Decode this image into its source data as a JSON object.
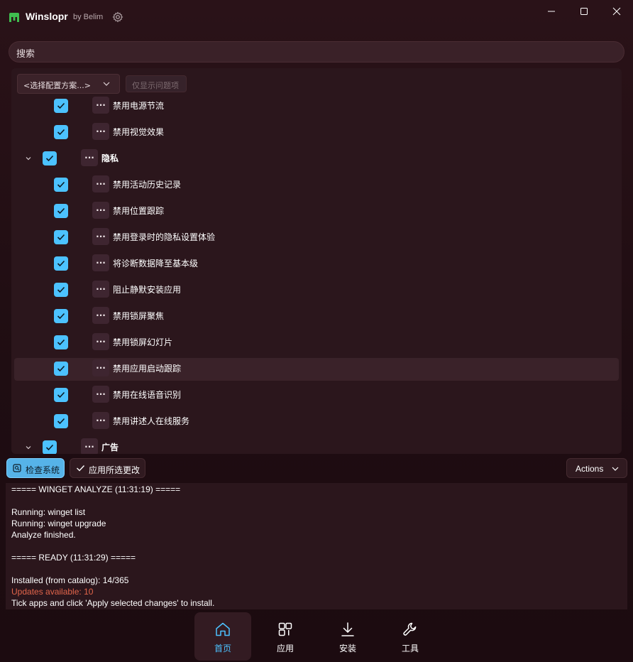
{
  "app": {
    "name": "Winslopr",
    "by": "by Belim"
  },
  "search": {
    "placeholder": "搜索"
  },
  "toolbar": {
    "preset_label": "<选择配置方案...>",
    "only_issues_label": "仅显示问题项"
  },
  "tweaks": [
    {
      "type": "item",
      "label": "禁用电源节流",
      "checked": true
    },
    {
      "type": "item",
      "label": "禁用视觉效果",
      "checked": true
    },
    {
      "type": "group",
      "label": "隐私",
      "checked": true,
      "expanded": true
    },
    {
      "type": "item",
      "label": "禁用活动历史记录",
      "checked": true
    },
    {
      "type": "item",
      "label": "禁用位置跟踪",
      "checked": true
    },
    {
      "type": "item",
      "label": "禁用登录时的隐私设置体验",
      "checked": true
    },
    {
      "type": "item",
      "label": "将诊断数据降至基本级",
      "checked": true
    },
    {
      "type": "item",
      "label": "阻止静默安装应用",
      "checked": true
    },
    {
      "type": "item",
      "label": "禁用锁屏聚焦",
      "checked": true
    },
    {
      "type": "item",
      "label": "禁用锁屏幻灯片",
      "checked": true
    },
    {
      "type": "item",
      "label": "禁用应用启动跟踪",
      "checked": true,
      "highlighted": true
    },
    {
      "type": "item",
      "label": "禁用在线语音识别",
      "checked": true
    },
    {
      "type": "item",
      "label": "禁用讲述人在线服务",
      "checked": true
    },
    {
      "type": "group",
      "label": "广告",
      "checked": true,
      "expanded": true
    }
  ],
  "more_glyph": "···",
  "buttons": {
    "check_system": "检查系统",
    "apply_changes": "应用所选更改",
    "actions": "Actions"
  },
  "log": [
    {
      "text": "===== WINGET ANALYZE (11:31:19) ====="
    },
    {
      "text": ""
    },
    {
      "text": "Running: winget list"
    },
    {
      "text": "Running: winget upgrade"
    },
    {
      "text": "Analyze finished."
    },
    {
      "text": ""
    },
    {
      "text": "===== READY (11:31:29) ====="
    },
    {
      "text": ""
    },
    {
      "text": "Installed (from catalog): 14/365"
    },
    {
      "text": "Updates available: 10",
      "warn": true
    },
    {
      "text": "Tick apps and click 'Apply selected changes' to install."
    }
  ],
  "nav": [
    {
      "label": "首页",
      "icon": "home-icon",
      "active": true
    },
    {
      "label": "应用",
      "icon": "apps-icon",
      "active": false
    },
    {
      "label": "安装",
      "icon": "download-icon",
      "active": false
    },
    {
      "label": "工具",
      "icon": "wrench-icon",
      "active": false
    }
  ],
  "colors": {
    "accent": "#4cc2ff",
    "warning": "#e2654b",
    "background": "#22100f"
  }
}
